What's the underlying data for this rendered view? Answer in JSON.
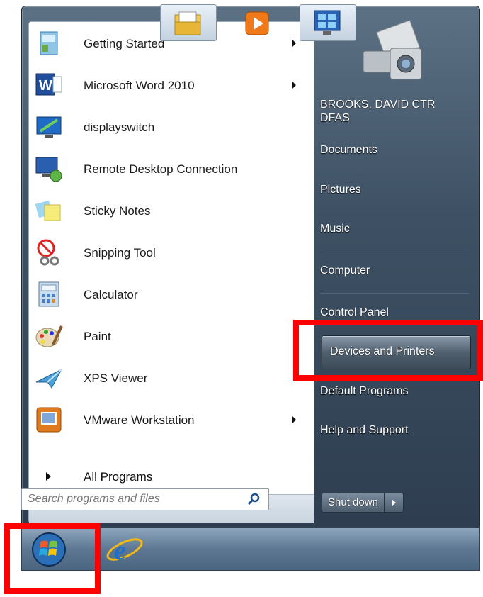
{
  "programs": [
    {
      "label": "Getting Started",
      "icon": "getting-started-icon",
      "has_submenu": true
    },
    {
      "label": "Microsoft Word 2010",
      "icon": "word-icon",
      "has_submenu": true
    },
    {
      "label": "displayswitch",
      "icon": "display-switch-icon",
      "has_submenu": false
    },
    {
      "label": "Remote Desktop Connection",
      "icon": "remote-desktop-icon",
      "has_submenu": false
    },
    {
      "label": "Sticky Notes",
      "icon": "sticky-notes-icon",
      "has_submenu": false
    },
    {
      "label": "Snipping Tool",
      "icon": "snipping-tool-icon",
      "has_submenu": false
    },
    {
      "label": "Calculator",
      "icon": "calculator-icon",
      "has_submenu": false
    },
    {
      "label": "Paint",
      "icon": "paint-icon",
      "has_submenu": false
    },
    {
      "label": "XPS Viewer",
      "icon": "xps-viewer-icon",
      "has_submenu": false
    },
    {
      "label": "VMware Workstation",
      "icon": "vmware-icon",
      "has_submenu": true
    }
  ],
  "all_programs": "All Programs",
  "search": {
    "placeholder": "Search programs and files"
  },
  "right": {
    "user_line1": "BROOKS, DAVID CTR",
    "user_line2": "DFAS",
    "documents": "Documents",
    "pictures": "Pictures",
    "music": "Music",
    "computer": "Computer",
    "control_panel": "Control Panel",
    "devices_printers": "Devices and Printers",
    "default_programs": "Default Programs",
    "help_support": "Help and Support",
    "shutdown": "Shut down"
  },
  "colors": {
    "highlight": "#ff0000",
    "menu_dark": "#2e3e50"
  }
}
